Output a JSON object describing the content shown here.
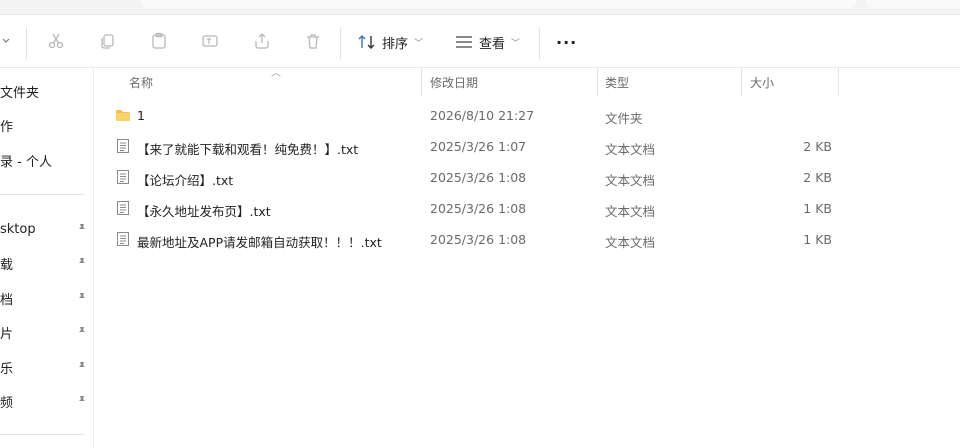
{
  "toolbar": {
    "icons": [
      "chevron-down-icon",
      "cut-icon",
      "copy-icon",
      "paste-icon",
      "rename-icon",
      "share-icon",
      "delete-icon"
    ],
    "sort_label": "排序",
    "view_label": "查看",
    "more_label": "···"
  },
  "nav": {
    "items": [
      {
        "label": "文件夹",
        "pinned": false
      },
      {
        "label": "作",
        "pinned": false
      },
      {
        "label": "录 - 个人",
        "pinned": false
      },
      {
        "label": "sktop",
        "pinned": true
      },
      {
        "label": "载",
        "pinned": true
      },
      {
        "label": "档",
        "pinned": true
      },
      {
        "label": "片",
        "pinned": true
      },
      {
        "label": "乐",
        "pinned": true
      },
      {
        "label": "频",
        "pinned": true
      }
    ]
  },
  "columns": {
    "name": "名称",
    "date": "修改日期",
    "type": "类型",
    "size": "大小"
  },
  "files": [
    {
      "icon": "folder-icon",
      "name": "1",
      "date": "2026/8/10 21:27",
      "type": "文件夹",
      "size": ""
    },
    {
      "icon": "text-file-icon",
      "name": "【来了就能下载和观看！纯免费！】.txt",
      "date": "2025/3/26 1:07",
      "type": "文本文档",
      "size": "2 KB"
    },
    {
      "icon": "text-file-icon",
      "name": "【论坛介绍】.txt",
      "date": "2025/3/26 1:08",
      "type": "文本文档",
      "size": "2 KB"
    },
    {
      "icon": "text-file-icon",
      "name": "【永久地址发布页】.txt",
      "date": "2025/3/26 1:08",
      "type": "文本文档",
      "size": "1 KB"
    },
    {
      "icon": "text-file-icon",
      "name": "最新地址及APP请发邮箱自动获取！！！.txt",
      "date": "2025/3/26 1:08",
      "type": "文本文档",
      "size": "1 KB"
    }
  ]
}
